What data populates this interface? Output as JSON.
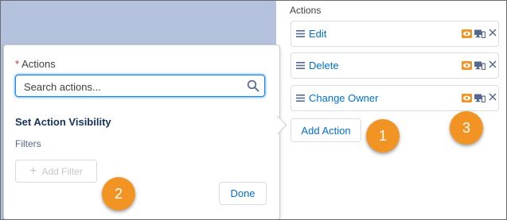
{
  "popover": {
    "actions_label": "Actions",
    "required_mark": "*",
    "search_placeholder": "Search actions...",
    "section_title": "Set Action Visibility",
    "filters_label": "Filters",
    "add_filter_label": "Add Filter",
    "done_label": "Done"
  },
  "right_panel": {
    "title": "Actions",
    "items": [
      {
        "label": "Edit"
      },
      {
        "label": "Delete"
      },
      {
        "label": "Change Owner"
      }
    ],
    "add_action_label": "Add Action"
  },
  "callouts": [
    "1",
    "2",
    "3"
  ],
  "colors": {
    "accent": "#0070d2",
    "badge": "#f29423",
    "visibility_icon": "#f29423",
    "background_dim": "#b4c2dd"
  },
  "icons": [
    "search-icon",
    "plus-icon",
    "drag-handle-icon",
    "visibility-eye-icon",
    "devices-icon",
    "close-icon"
  ]
}
